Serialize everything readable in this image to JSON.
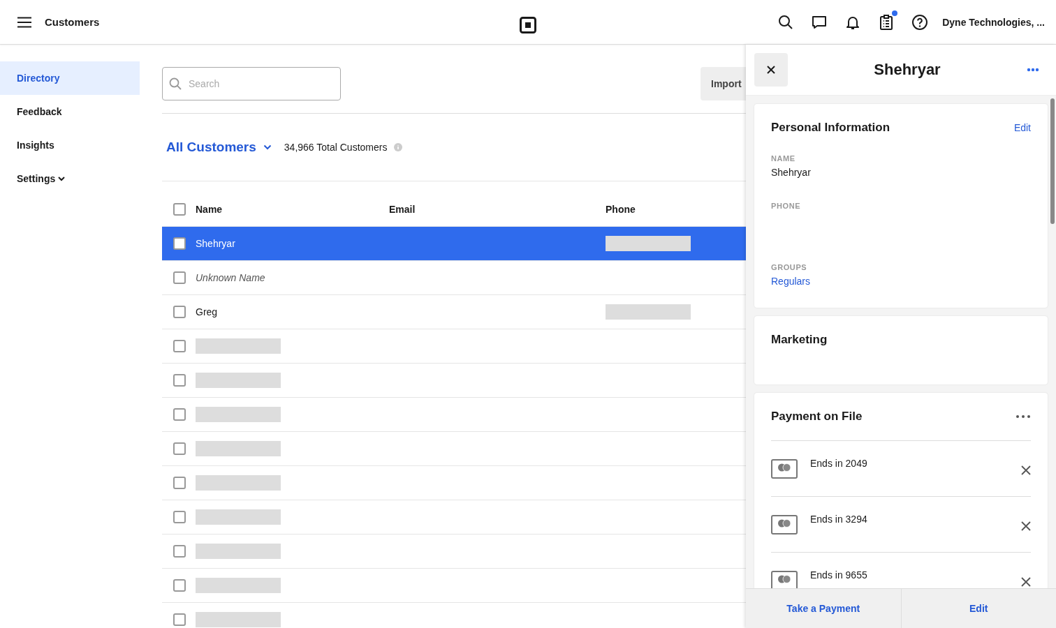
{
  "topbar": {
    "title": "Customers",
    "account": "Dyne Technologies, ...",
    "clipboard_badge": true
  },
  "sidebar": {
    "items": [
      {
        "label": "Directory",
        "selected": true,
        "kind": "link"
      },
      {
        "label": "Feedback",
        "selected": false,
        "kind": "link"
      },
      {
        "label": "Insights",
        "selected": false,
        "kind": "link"
      },
      {
        "label": "Settings",
        "selected": false,
        "kind": "dropdown"
      }
    ]
  },
  "search": {
    "placeholder": "Search"
  },
  "import_button": "Import",
  "list": {
    "title": "All Customers",
    "count": "34,966 Total Customers"
  },
  "table": {
    "columns": [
      "Name",
      "Email",
      "Phone"
    ],
    "header_checked": false,
    "rows": [
      {
        "kind": "customer",
        "name": "Shehryar",
        "unnamed": false,
        "selected": true,
        "checked": false,
        "phone_redacted": true
      },
      {
        "kind": "customer",
        "name": "Unknown Name",
        "unnamed": true,
        "selected": false,
        "checked": false,
        "phone_redacted": false
      },
      {
        "kind": "customer",
        "name": "Greg",
        "unnamed": false,
        "selected": false,
        "checked": false,
        "phone_redacted": true
      },
      {
        "kind": "loading",
        "checked": false
      },
      {
        "kind": "loading",
        "checked": false
      },
      {
        "kind": "loading",
        "checked": false
      },
      {
        "kind": "loading",
        "checked": false
      },
      {
        "kind": "loading",
        "checked": false
      },
      {
        "kind": "loading",
        "checked": false
      },
      {
        "kind": "loading",
        "checked": false
      },
      {
        "kind": "loading",
        "checked": false
      },
      {
        "kind": "loading",
        "checked": false
      }
    ]
  },
  "panel": {
    "title": "Shehryar",
    "personal": {
      "title": "Personal Information",
      "edit": "Edit",
      "fields": [
        {
          "label": "NAME",
          "value": "Shehryar",
          "kind": "text"
        },
        {
          "label": "PHONE",
          "kind": "empty"
        },
        {
          "label": "GROUPS",
          "value": "Regulars",
          "kind": "link"
        }
      ]
    },
    "marketing": {
      "title": "Marketing"
    },
    "payment": {
      "title": "Payment on File",
      "cards": [
        {
          "label": "Ends in 2049"
        },
        {
          "label": "Ends in 3294"
        },
        {
          "label": "Ends in 9655"
        }
      ]
    },
    "footer": [
      "Take a Payment",
      "Edit"
    ]
  }
}
